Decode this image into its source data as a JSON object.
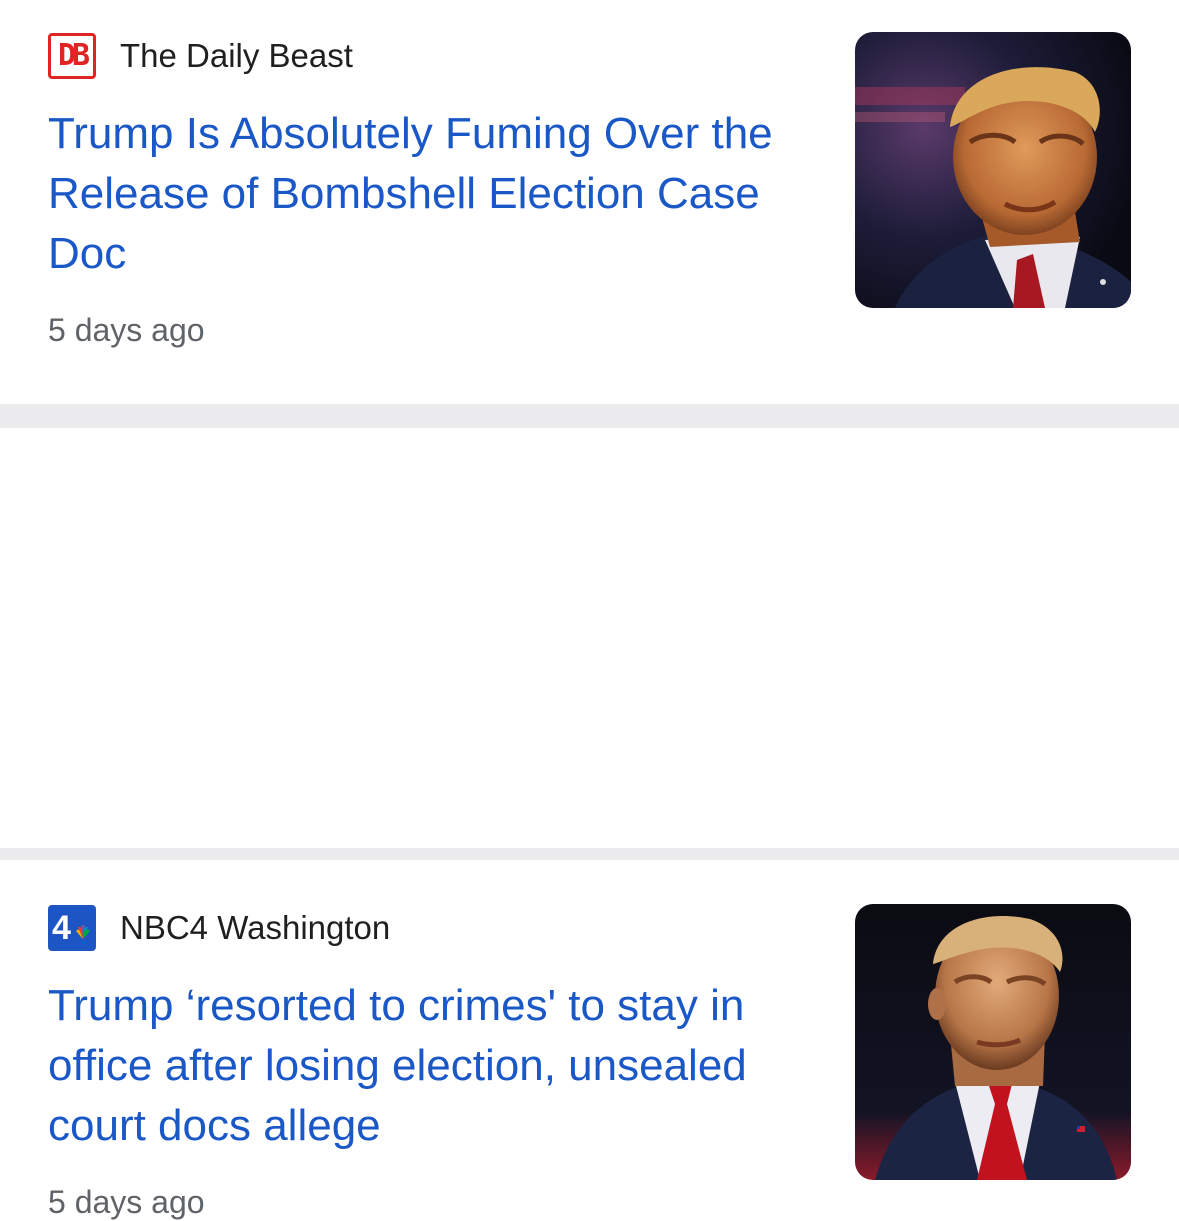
{
  "articles": [
    {
      "source": "The Daily Beast",
      "source_logo_icon": "daily-beast-logo-icon",
      "logo_text": "DB",
      "headline": "Trump Is Absolutely Fuming Over the Release of Bombshell Election Case Doc",
      "time": "5 days ago",
      "thumbnail": "news-photo"
    },
    {
      "source": "NBC4 Washington",
      "source_logo_icon": "nbc4-logo-icon",
      "logo_text": "4",
      "headline": "Trump ‘resorted to crimes' to stay in office after losing election, unsealed court docs allege",
      "time": "5 days ago",
      "thumbnail": "news-photo"
    }
  ],
  "colors": {
    "headline": "#1a57c7",
    "source": "#1f1f1f",
    "timestamp": "#5f6368",
    "divider": "#ececee",
    "daily_beast_red": "#e02424",
    "nbc_blue": "#1d55c4"
  }
}
